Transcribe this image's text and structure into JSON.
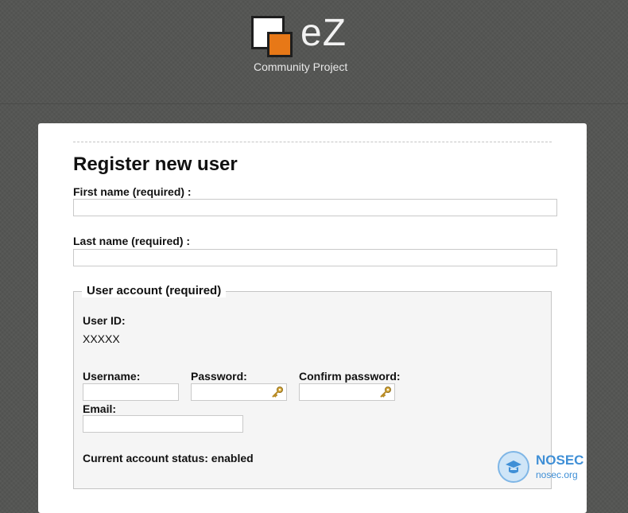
{
  "header": {
    "brand": "eZ",
    "tagline": "Community Project"
  },
  "form": {
    "title": "Register new user",
    "first_name_label": "First name (required) :",
    "last_name_label": "Last name (required) :",
    "account": {
      "legend": "User account (required)",
      "user_id_label": "User ID:",
      "user_id_value": "XXXXX",
      "username_label": "Username:",
      "password_label": "Password:",
      "confirm_password_label": "Confirm password:",
      "email_label": "Email:",
      "status_text": "Current account status: enabled"
    }
  },
  "watermark": {
    "name": "NOSEC",
    "url": "nosec.org"
  },
  "icons": {
    "password_key": "key-icon",
    "confirm_key": "key-icon"
  },
  "colors": {
    "brand_orange": "#e77817",
    "background": "#555654",
    "watermark_blue": "#3f8fd6"
  }
}
